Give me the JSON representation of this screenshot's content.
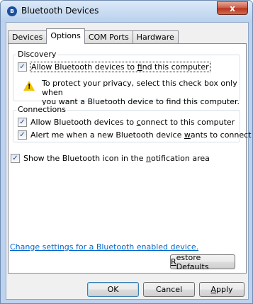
{
  "window": {
    "title": "Bluetooth Devices",
    "title_icon": "bluetooth-icon",
    "close_glyph": "x"
  },
  "tabs": [
    {
      "label": "Devices",
      "active": false
    },
    {
      "label": "Options",
      "active": true
    },
    {
      "label": "COM Ports",
      "active": false
    },
    {
      "label": "Hardware",
      "active": false
    }
  ],
  "discovery": {
    "legend": "Discovery",
    "allow_find": {
      "checked": true,
      "pre": "Allow Bluetooth devices to ",
      "accel": "f",
      "post": "ind this computer"
    },
    "warning_icon": "warning-icon",
    "warning_line1": "To protect your privacy, select this check box only when",
    "warning_line2": "you want a Bluetooth device to find this computer."
  },
  "connections": {
    "legend": "Connections",
    "allow_connect": {
      "checked": true,
      "pre": "Allow Bluetooth devices to ",
      "accel": "c",
      "post": "onnect to this computer"
    },
    "alert_new": {
      "checked": true,
      "pre": "Alert me when a new Bluetooth device ",
      "accel": "w",
      "post": "ants to connect"
    }
  },
  "show_icon": {
    "checked": true,
    "pre": "Show the Bluetooth icon in the ",
    "accel": "n",
    "post": "otification area"
  },
  "settings_link": "Change settings for a Bluetooth enabled device.",
  "restore_defaults": {
    "accel": "R",
    "post": "estore Defaults"
  },
  "footer": {
    "ok": "OK",
    "cancel": "Cancel",
    "apply": {
      "accel": "A",
      "post": "pply"
    }
  },
  "colors": {
    "link": "#0066cc",
    "warning": "#f2c300"
  }
}
